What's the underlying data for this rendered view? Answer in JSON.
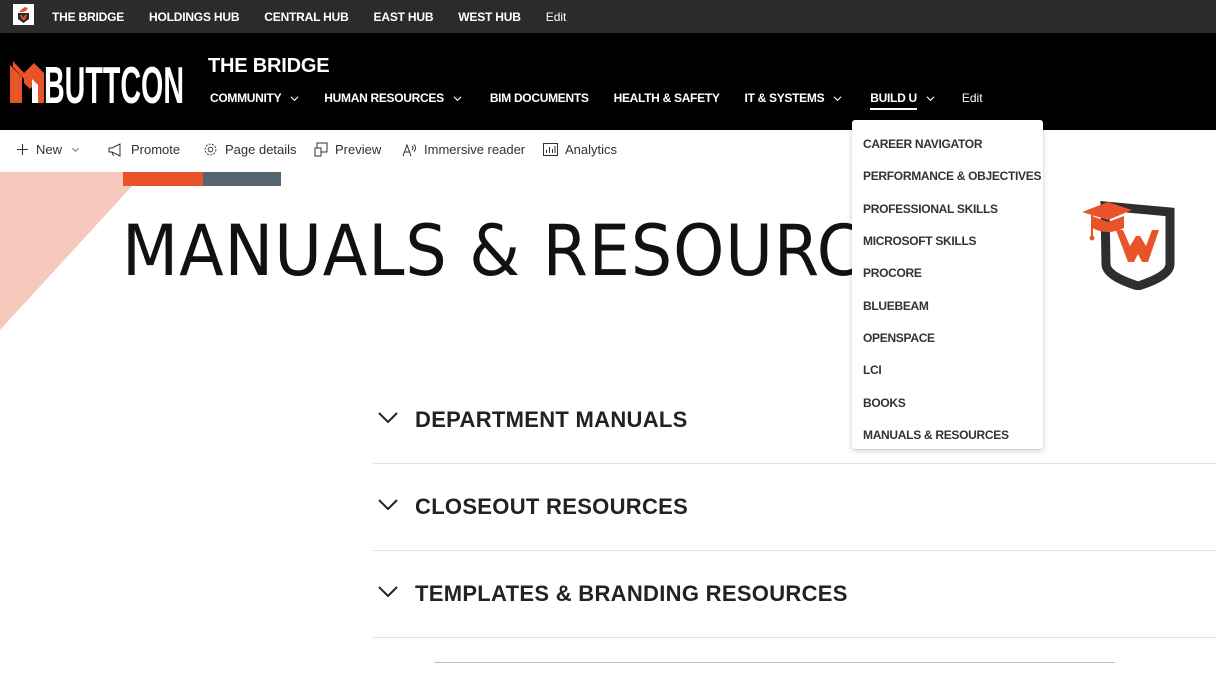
{
  "hub_bar": {
    "links": [
      "THE BRIDGE",
      "HOLDINGS HUB",
      "CENTRAL HUB",
      "EAST HUB",
      "WEST HUB"
    ],
    "edit_label": "Edit"
  },
  "site": {
    "logo_text": "BUTTCON",
    "title": "THE BRIDGE",
    "nav": [
      {
        "label": "COMMUNITY",
        "has_menu": true
      },
      {
        "label": "HUMAN RESOURCES",
        "has_menu": true
      },
      {
        "label": "BIM DOCUMENTS",
        "has_menu": false
      },
      {
        "label": "HEALTH & SAFETY",
        "has_menu": false
      },
      {
        "label": "IT & SYSTEMS",
        "has_menu": true
      },
      {
        "label": "BUILD U",
        "has_menu": true,
        "active": true
      }
    ],
    "edit_label": "Edit"
  },
  "command_bar": {
    "new_label": "New",
    "promote_label": "Promote",
    "page_details_label": "Page details",
    "preview_label": "Preview",
    "immersive_reader_label": "Immersive reader",
    "analytics_label": "Analytics"
  },
  "hero": {
    "title": "MANUALS & RESOURCES"
  },
  "accordions": [
    {
      "title": "DEPARTMENT MANUALS"
    },
    {
      "title": "CLOSEOUT RESOURCES"
    },
    {
      "title": "TEMPLATES & BRANDING RESOURCES"
    }
  ],
  "build_u_menu": [
    "CAREER NAVIGATOR",
    "PERFORMANCE & OBJECTIVES",
    "PROFESSIONAL SKILLS",
    "MICROSOFT SKILLS",
    "PROCORE",
    "BLUEBEAM",
    "OPENSPACE",
    "LCI",
    "BOOKS",
    "MANUALS & RESOURCES"
  ],
  "colors": {
    "accent_orange": "#e8532a",
    "accent_gray": "#56666f",
    "header_black": "#000000",
    "hubbar_dark": "#2b2b2b",
    "hero_triangle": "#f7c9bd"
  },
  "icons": {
    "new": "plus-icon",
    "promote": "megaphone-icon",
    "page_details": "gear-icon",
    "preview": "preview-icon",
    "immersive_reader": "immersive-reader-icon",
    "analytics": "analytics-icon"
  }
}
